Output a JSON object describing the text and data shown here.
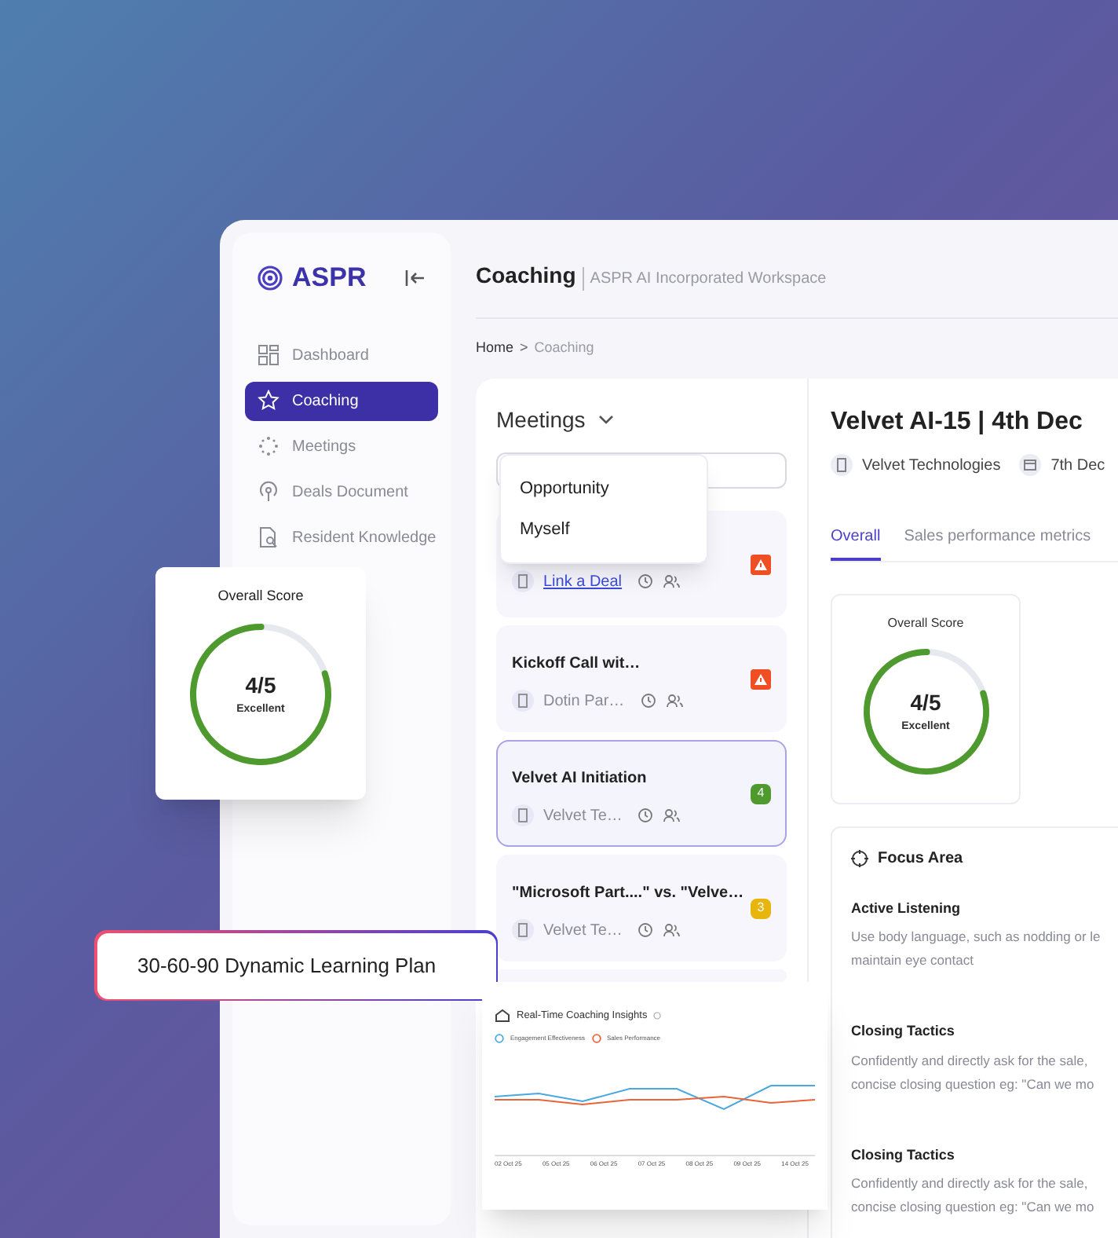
{
  "sidebar": {
    "logo": "ASPR",
    "items": [
      {
        "label": "Dashboard",
        "selected": false
      },
      {
        "label": "Coaching",
        "selected": true
      },
      {
        "label": "Meetings",
        "selected": false
      },
      {
        "label": "Deals Document",
        "selected": false
      },
      {
        "label": "Resident Knowledge",
        "selected": false
      }
    ]
  },
  "header": {
    "title": "Coaching",
    "subtitle": "ASPR AI Incorporated Workspace"
  },
  "breadcrumb": [
    {
      "label": "Home",
      "current": false
    },
    {
      "label": "Coaching",
      "current": true
    }
  ],
  "breadcrumb_separator": ">",
  "meetings": {
    "title": "Meetings",
    "cards": [
      {
        "company": "Link a Deal",
        "link": true,
        "selected": false,
        "badge": {
          "kind": "alert",
          "color": "#f04e23"
        }
      },
      {
        "title": "Kickoff Call wit…",
        "company": "Dotin Par…",
        "link": false,
        "selected": false,
        "badge": {
          "kind": "alert",
          "color": "#f04e23"
        }
      },
      {
        "title": "Velvet AI Initiation",
        "company": "Velvet Te…",
        "link": false,
        "selected": true,
        "badge": {
          "kind": "score",
          "text": "4",
          "color": "#4e9a2e"
        }
      },
      {
        "title": "\"Microsoft Part....\" vs. \"Velve…",
        "company": "Velvet Te…",
        "link": false,
        "selected": false,
        "badge": {
          "kind": "score",
          "text": "3",
          "color": "#e8b50c"
        }
      },
      {
        "selected": false
      }
    ]
  },
  "dropdown": {
    "options": [
      "Opportunity",
      "Myself"
    ]
  },
  "detail": {
    "title": "Velvet AI-15 | 4th Dec",
    "company": "Velvet Technologies",
    "date": "7th Dec",
    "tabs": [
      {
        "label": "Overall",
        "selected": true
      },
      {
        "label": "Sales performance metrics",
        "selected": false
      }
    ],
    "score": {
      "title": "Overall Score",
      "value": "4/5",
      "rating": "Excellent",
      "level": 0.8
    },
    "focus": {
      "title": "Focus Area",
      "items": [
        {
          "title": "Active Listening",
          "lines": [
            "Use body language, such as nodding or le",
            "maintain eye contact"
          ]
        },
        {
          "title": "Closing Tactics",
          "lines": [
            "Confidently and directly ask for the sale,",
            "concise closing question eg: \"Can we mo"
          ]
        },
        {
          "title": "Closing Tactics",
          "lines": [
            "Confidently and directly ask for the sale,",
            "concise closing question eg: \"Can we mo"
          ]
        }
      ]
    }
  },
  "floating_score": {
    "title": "Overall Score",
    "value": "4/5",
    "rating": "Excellent",
    "level": 0.8
  },
  "plan_label": "30-60-90 Dynamic Learning Plan",
  "insights": {
    "title": "Real-Time Coaching Insights",
    "legend": [
      {
        "name": "Engagement Effectiveness",
        "color": "#4aa8e0"
      },
      {
        "name": "Sales Performance",
        "color": "#e8643a"
      }
    ],
    "x_labels": [
      "02 Oct 25",
      "05 Oct 25",
      "06 Oct 25",
      "07 Oct 25",
      "08 Oct 25",
      "09 Oct 25",
      "14 Oct 25"
    ]
  }
}
